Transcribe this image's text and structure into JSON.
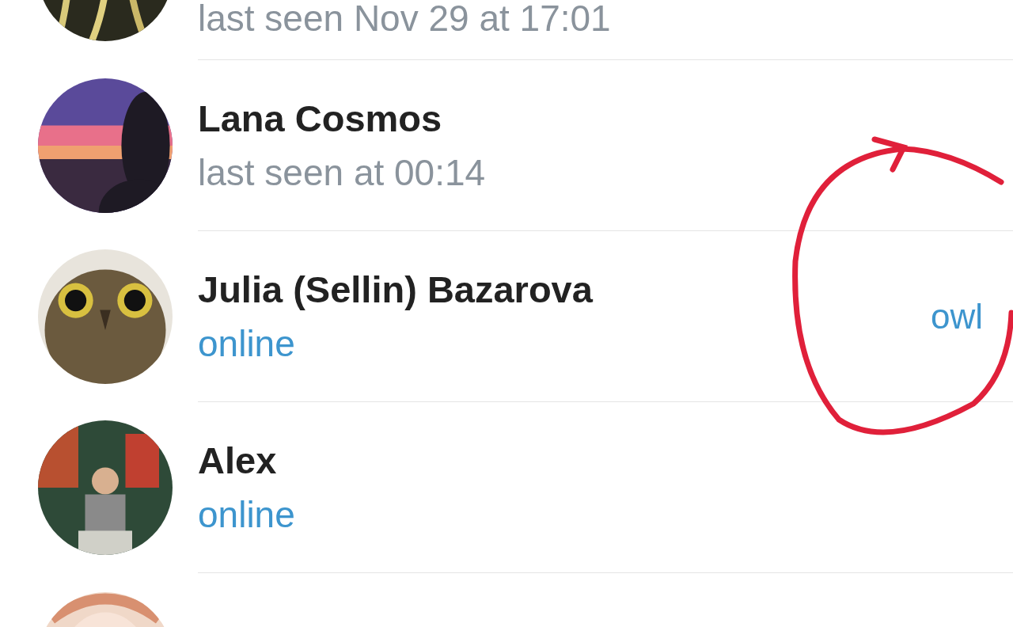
{
  "contacts": [
    {
      "kind": "picture",
      "status": "last seen Nov 29 at 17:01",
      "online": false
    },
    {
      "kind": "picture",
      "name": "Lana Cosmos",
      "status": "last seen at 00:14",
      "online": false
    },
    {
      "kind": "picture",
      "name": "Julia (Sellin) Bazarova",
      "status": "online",
      "online": true,
      "tag": "owl"
    },
    {
      "kind": "picture",
      "name": "Alex",
      "status": "online",
      "online": true
    },
    {
      "kind": "picture"
    }
  ]
}
